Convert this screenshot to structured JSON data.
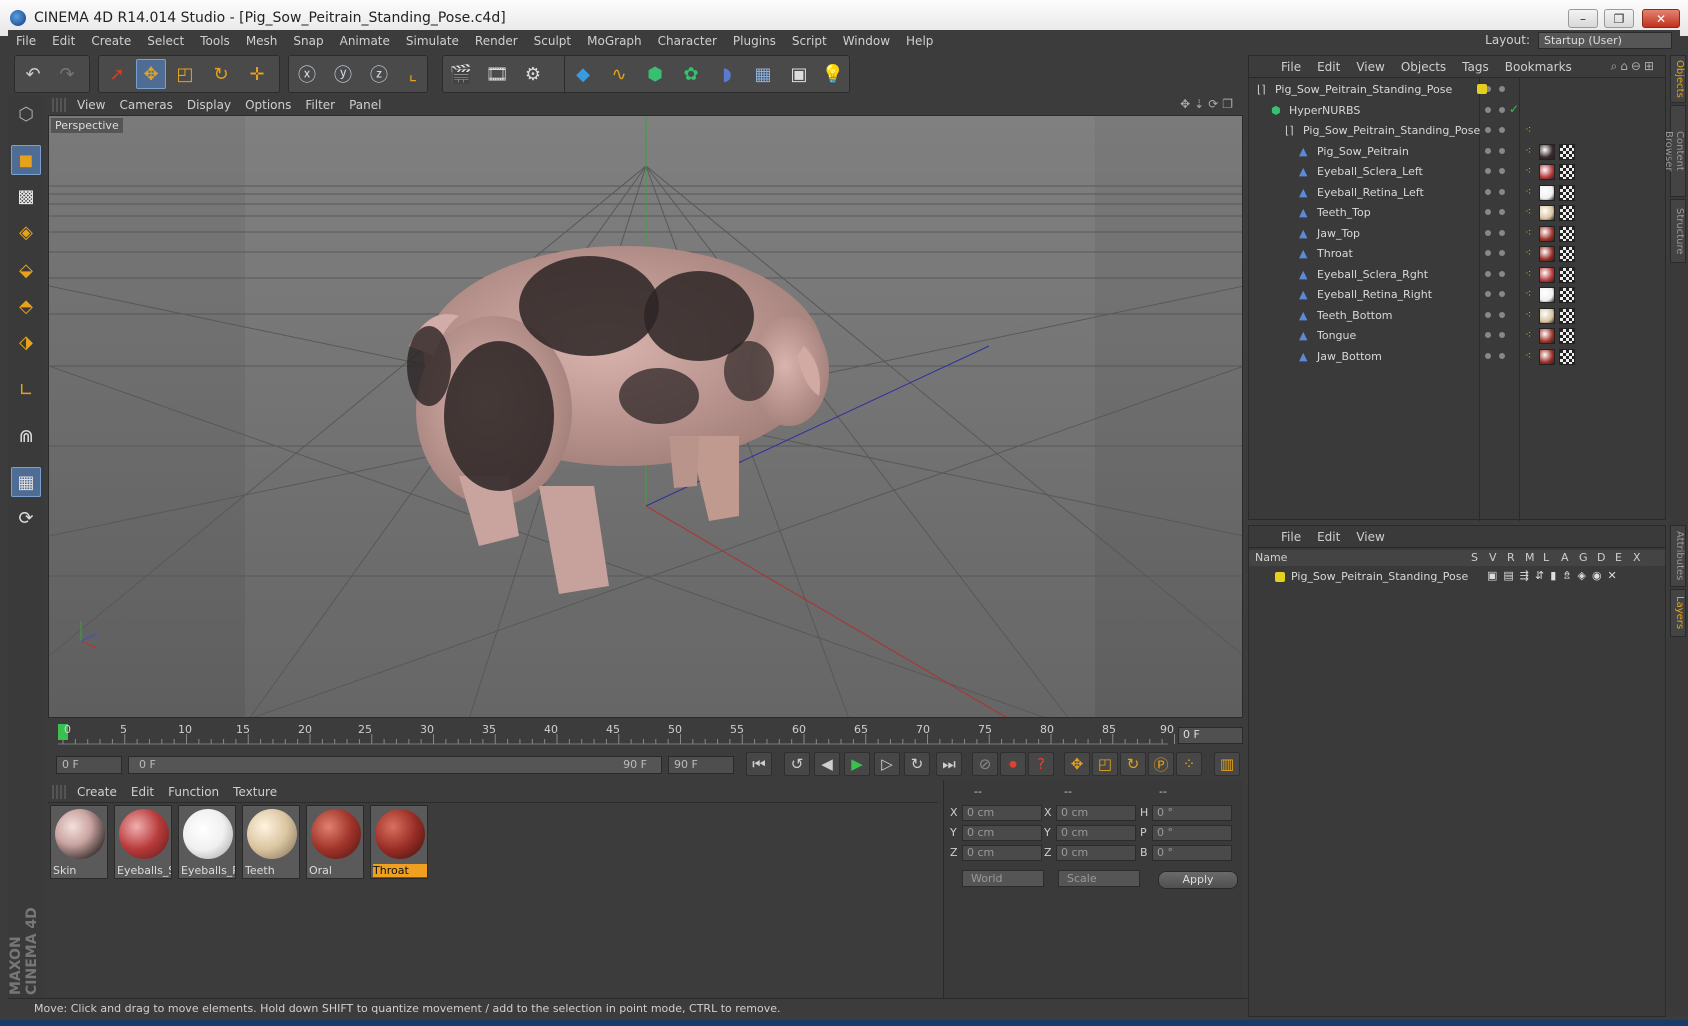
{
  "window": {
    "title": "CINEMA 4D R14.014 Studio - [Pig_Sow_Peitrain_Standing_Pose.c4d]"
  },
  "menubar": {
    "items": [
      "File",
      "Edit",
      "Create",
      "Select",
      "Tools",
      "Mesh",
      "Snap",
      "Animate",
      "Simulate",
      "Render",
      "Sculpt",
      "MoGraph",
      "Character",
      "Plugins",
      "Script",
      "Window",
      "Help"
    ],
    "layout_label": "Layout:",
    "layout_value": "Startup (User)"
  },
  "viewport": {
    "menu": [
      "View",
      "Cameras",
      "Display",
      "Options",
      "Filter",
      "Panel"
    ],
    "camera_label": "Perspective"
  },
  "timeline": {
    "ticks": [
      "0",
      "5",
      "10",
      "15",
      "20",
      "25",
      "30",
      "35",
      "40",
      "45",
      "50",
      "55",
      "60",
      "65",
      "70",
      "75",
      "80",
      "85",
      "90"
    ],
    "current_frame": "0 F"
  },
  "transport": {
    "start_field": "0 F",
    "range_start": "0 F",
    "range_end": "90 F",
    "end_field": "90 F"
  },
  "materials": {
    "menu": [
      "Create",
      "Edit",
      "Function",
      "Texture"
    ],
    "items": [
      {
        "label": "Skin",
        "color": "#c9a4a0"
      },
      {
        "label": "Eyeballs_Sc",
        "color": "#b83a3a"
      },
      {
        "label": "Eyeballs_Re",
        "color": "#f0f0f0"
      },
      {
        "label": "Teeth",
        "color": "#d9c4a0"
      },
      {
        "label": "Oral",
        "color": "#a0342a"
      },
      {
        "label": "Throat",
        "color": "#9a2e26"
      }
    ]
  },
  "coordinates": {
    "headers": [
      "--",
      "--",
      "--"
    ],
    "rows": [
      {
        "a": "X",
        "av": "0 cm",
        "b": "X",
        "bv": "0 cm",
        "c": "H",
        "cv": "0 °"
      },
      {
        "a": "Y",
        "av": "0 cm",
        "b": "Y",
        "bv": "0 cm",
        "c": "P",
        "cv": "0 °"
      },
      {
        "a": "Z",
        "av": "0 cm",
        "b": "Z",
        "bv": "0 cm",
        "c": "B",
        "cv": "0 °"
      }
    ],
    "space": "World",
    "mode": "Scale",
    "apply": "Apply"
  },
  "objects": {
    "menu": [
      "File",
      "Edit",
      "View",
      "Objects",
      "Tags",
      "Bookmarks"
    ],
    "tree": [
      {
        "name": "Pig_Sow_Peitrain_Standing_Pose",
        "level": 0
      },
      {
        "name": "HyperNURBS",
        "level": 1
      },
      {
        "name": "Pig_Sow_Peitrain_Standing_Pose",
        "level": 2
      },
      {
        "name": "Pig_Sow_Peitrain",
        "level": 3
      },
      {
        "name": "Eyeball_Sclera_Left",
        "level": 3
      },
      {
        "name": "Eyeball_Retina_Left",
        "level": 3
      },
      {
        "name": "Teeth_Top",
        "level": 3
      },
      {
        "name": "Jaw_Top",
        "level": 3
      },
      {
        "name": "Throat",
        "level": 3
      },
      {
        "name": "Eyeball_Sclera_Rght",
        "level": 3
      },
      {
        "name": "Eyeball_Retina_Right",
        "level": 3
      },
      {
        "name": "Teeth_Bottom",
        "level": 3
      },
      {
        "name": "Tongue",
        "level": 3
      },
      {
        "name": "Jaw_Bottom",
        "level": 3
      }
    ]
  },
  "layers": {
    "menu": [
      "File",
      "Edit",
      "View"
    ],
    "columns": [
      "Name",
      "S",
      "V",
      "R",
      "M",
      "L",
      "A",
      "G",
      "D",
      "E",
      "X"
    ],
    "row": "Pig_Sow_Peitrain_Standing_Pose"
  },
  "side_tabs": [
    "Objects",
    "Content Browser",
    "Structure",
    "Attributes",
    "Layers"
  ],
  "status": "Move: Click and drag to move elements. Hold down SHIFT to quantize movement / add to the selection in point mode, CTRL to remove.",
  "brand": "MAXON CINEMA 4D"
}
